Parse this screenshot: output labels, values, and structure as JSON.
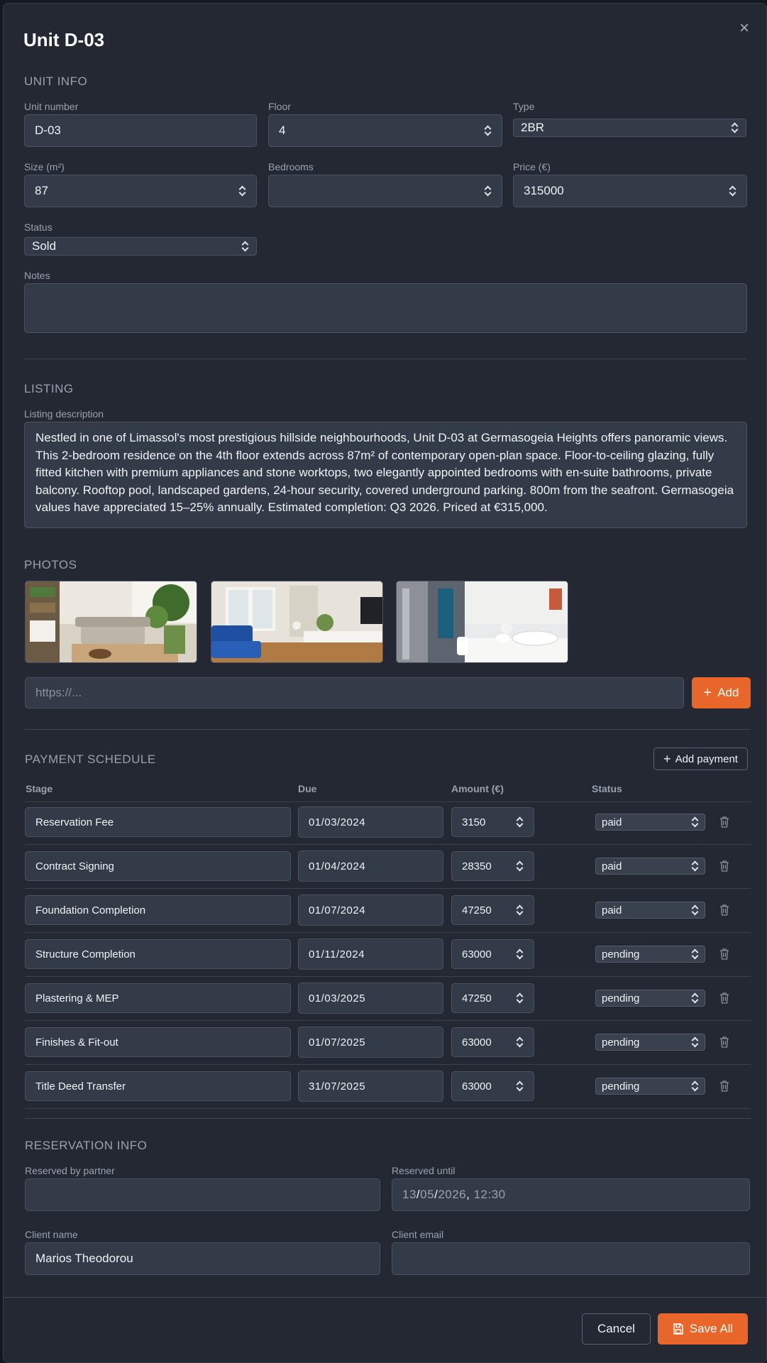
{
  "title": "Unit D-03",
  "unit_info": {
    "section_label": "UNIT INFO",
    "unit_number_label": "Unit number",
    "unit_number_value": "D-03",
    "floor_label": "Floor",
    "floor_value": "4",
    "type_label": "Type",
    "type_value": "2BR",
    "size_label": "Size (m²)",
    "size_value": "87",
    "bedrooms_label": "Bedrooms",
    "bedrooms_value": "",
    "price_label": "Price (€)",
    "price_value": "315000",
    "status_label": "Status",
    "status_value": "Sold",
    "notes_label": "Notes",
    "notes_value": ""
  },
  "listing": {
    "section_label": "LISTING",
    "description_label": "Listing description",
    "description_value": "Nestled in one of Limassol's most prestigious hillside neighbourhoods, Unit D-03 at Germasogeia Heights offers panoramic views. This 2-bedroom residence on the 4th floor extends across 87m² of contemporary open-plan space. Floor-to-ceiling glazing, fully fitted kitchen with premium appliances and stone worktops, two elegantly appointed bedrooms with en-suite bathrooms, private balcony. Rooftop pool, landscaped gardens, 24-hour security, covered underground parking. 800m from the seafront. Germasogeia values have appreciated 15–25% annually. Estimated completion: Q3 2026. Priced at €315,000."
  },
  "photos": {
    "section_label": "PHOTOS",
    "url_placeholder": "https://...",
    "add_label": "Add"
  },
  "payment_schedule": {
    "section_label": "PAYMENT SCHEDULE",
    "add_payment_label": "Add payment",
    "headers": {
      "stage": "Stage",
      "due": "Due",
      "amount": "Amount (€)",
      "status": "Status"
    },
    "rows": [
      {
        "stage": "Reservation Fee",
        "due": "01/03/2024",
        "amount": "3150",
        "status": "paid"
      },
      {
        "stage": "Contract Signing",
        "due": "01/04/2024",
        "amount": "28350",
        "status": "paid"
      },
      {
        "stage": "Foundation Completion",
        "due": "01/07/2024",
        "amount": "47250",
        "status": "paid"
      },
      {
        "stage": "Structure Completion",
        "due": "01/11/2024",
        "amount": "63000",
        "status": "pending"
      },
      {
        "stage": "Plastering & MEP",
        "due": "01/03/2025",
        "amount": "47250",
        "status": "pending"
      },
      {
        "stage": "Finishes & Fit-out",
        "due": "01/07/2025",
        "amount": "63000",
        "status": "pending"
      },
      {
        "stage": "Title Deed Transfer",
        "due": "31/07/2025",
        "amount": "63000",
        "status": "pending"
      }
    ]
  },
  "reservation": {
    "section_label": "RESERVATION INFO",
    "partner_label": "Reserved by partner",
    "partner_value": "",
    "until_label": "Reserved until",
    "until_day": "13",
    "until_month": "05",
    "until_year": "2026",
    "until_time": "12:30",
    "client_name_label": "Client name",
    "client_name_value": "Marios Theodorou",
    "client_email_label": "Client email",
    "client_email_value": ""
  },
  "footer": {
    "cancel_label": "Cancel",
    "save_label": "Save All"
  },
  "colors": {
    "accent": "#e8662a",
    "panel": "#232833",
    "input": "#343b48"
  }
}
